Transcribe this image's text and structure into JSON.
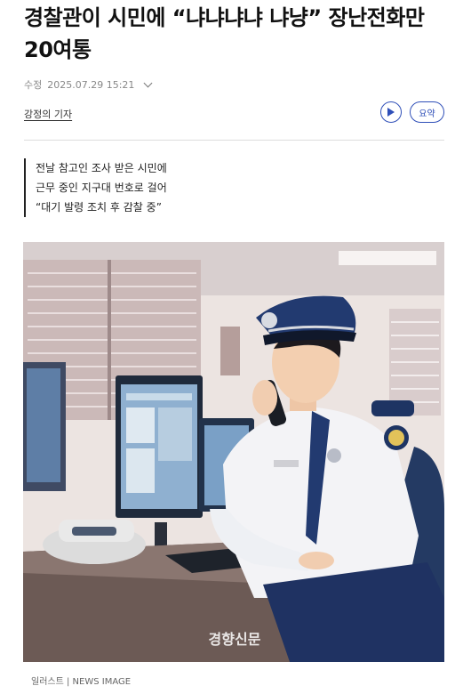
{
  "article": {
    "title": "경찰관이 시민에 “냐냐냐냐 냐냥” 장난전화만 20여통",
    "modified_label": "수정",
    "modified_time": "2025.07.29 15:21",
    "author": "강정의 기자",
    "summary_button": "요약",
    "subheadings": [
      "전날 참고인 조사 받은 시민에",
      "근무 중인 지구대 번호로 걸어",
      "“대기 발령 조치 후 감찰 중”"
    ],
    "image_watermark": "경향신문",
    "caption": "일러스트 | NEWS IMAGE"
  },
  "icons": {
    "expand": "chevron-down-icon",
    "play": "play-icon"
  },
  "colors": {
    "accent": "#2f4fb8",
    "title": "#111111",
    "meta": "#888888"
  }
}
